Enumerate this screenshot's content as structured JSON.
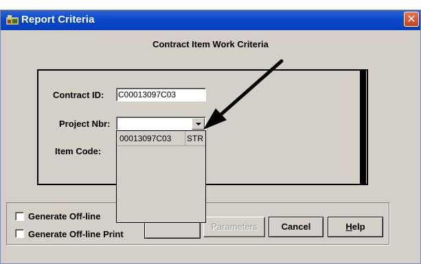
{
  "window": {
    "title": "Report Criteria",
    "close_glyph": "✕"
  },
  "criteria": {
    "section_title": "Contract Item Work Criteria",
    "contract_id_label": "Contract ID:",
    "contract_id_value": "C00013097C03",
    "project_nbr_label": "Project Nbr:",
    "project_nbr_value": "",
    "item_code_label": "Item Code:"
  },
  "dropdown": {
    "options": [
      {
        "col1": "00013097C03",
        "col2": "STR"
      }
    ]
  },
  "options": {
    "checkbox1_label": "Generate Off-line",
    "checkbox2_label": "Generate Off-line Print",
    "checkbox1_checked": false,
    "checkbox2_checked": false
  },
  "buttons": {
    "parameters": "Parameters",
    "cancel": "Cancel",
    "help": "Help"
  },
  "colors": {
    "titlebar": "#0a49c9",
    "dialog_bg": "#d4d0c8",
    "close_button": "#d9532c"
  },
  "icons": {
    "app": "report-app-icon",
    "dropdown": "chevron-down-icon",
    "annotation": "annotation-arrow-icon"
  }
}
